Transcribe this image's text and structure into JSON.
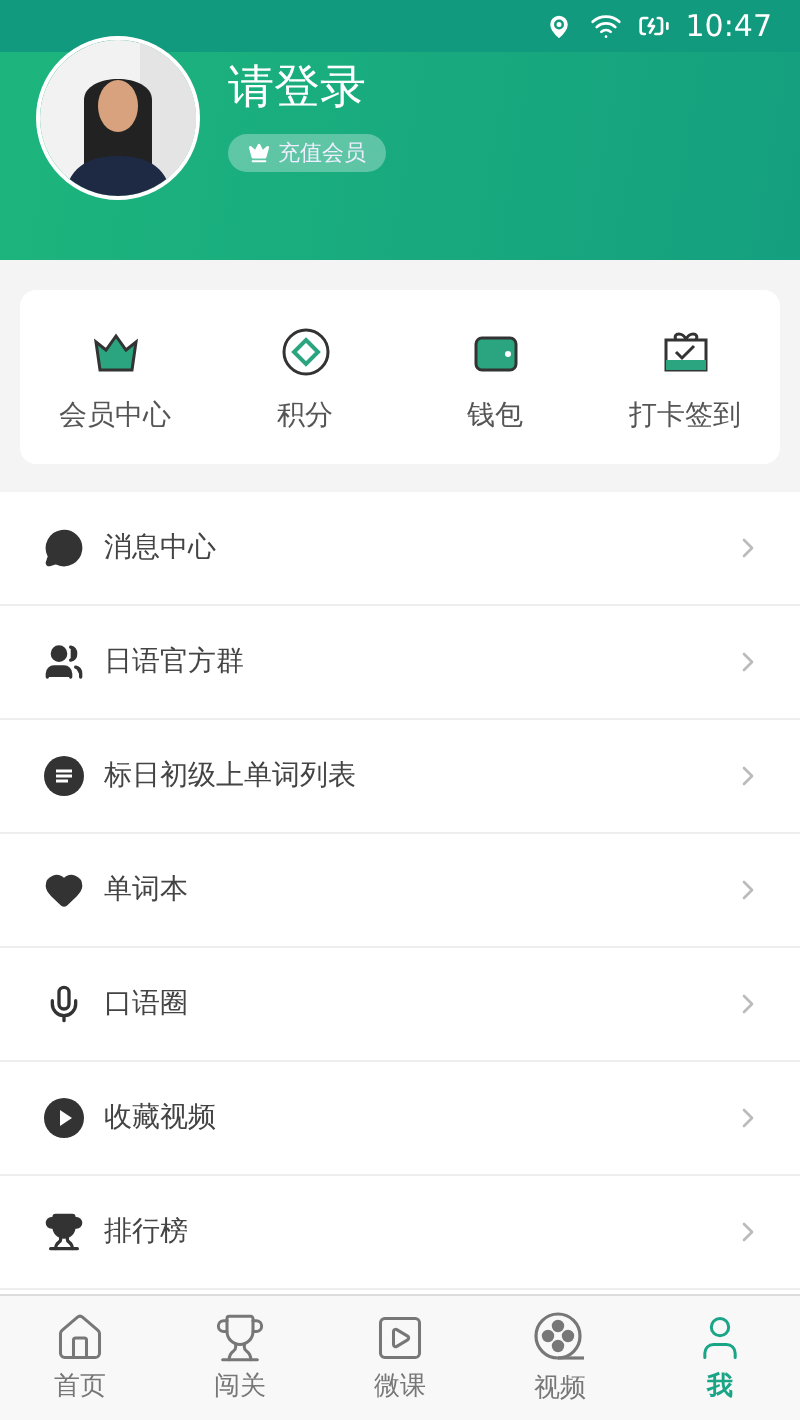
{
  "status_bar": {
    "time": "10:47"
  },
  "profile": {
    "name": "请登录",
    "badge": "充值会员"
  },
  "shortcuts": [
    {
      "label": "会员中心",
      "kind": "crown"
    },
    {
      "label": "积分",
      "kind": "points"
    },
    {
      "label": "钱包",
      "kind": "wallet"
    },
    {
      "label": "打卡签到",
      "kind": "gift"
    }
  ],
  "menu": [
    {
      "label": "消息中心",
      "kind": "chat"
    },
    {
      "label": "日语官方群",
      "kind": "group"
    },
    {
      "label": "标日初级上单词列表",
      "kind": "list"
    },
    {
      "label": "单词本",
      "kind": "heart"
    },
    {
      "label": "口语圈",
      "kind": "mic"
    },
    {
      "label": "收藏视频",
      "kind": "play"
    },
    {
      "label": "排行榜",
      "kind": "rank"
    }
  ],
  "tabs": [
    {
      "label": "首页",
      "kind": "home",
      "selected": false
    },
    {
      "label": "闯关",
      "kind": "trophy",
      "selected": false
    },
    {
      "label": "微课",
      "kind": "video",
      "selected": false
    },
    {
      "label": "视频",
      "kind": "reel",
      "selected": false
    },
    {
      "label": "我",
      "kind": "user",
      "selected": true
    }
  ]
}
